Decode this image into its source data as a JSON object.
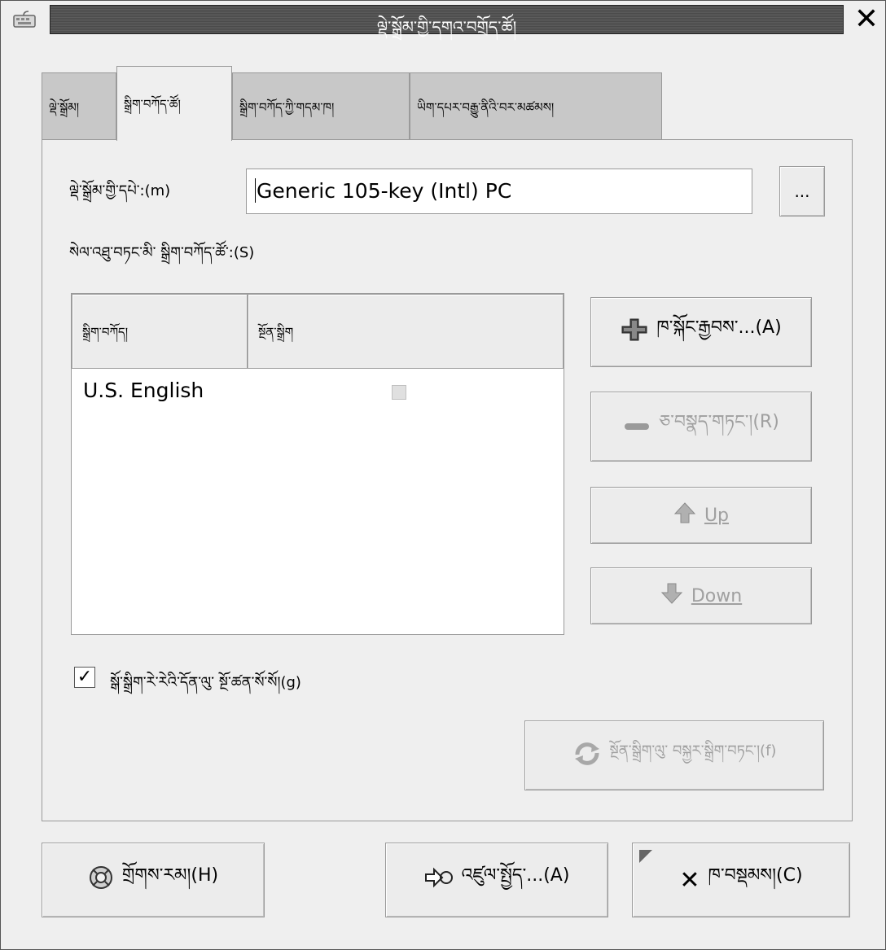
{
  "window": {
    "title": "ལྡེ་སྒྲོམ་གྱི་དགའ་བགྲོད་ཚོ།",
    "close_label": "✕"
  },
  "tabs": [
    {
      "label": "ལྡེ་སྒྲོམ།",
      "active": false
    },
    {
      "label": "སྒྲིག་བཀོད་ཚོ།",
      "active": true
    },
    {
      "label": "སྒྲིག་བཀོད་ཀྱི་གདམ་ཁ།",
      "active": false
    },
    {
      "label": "ཡིག་དཔར་བརྒྱུ་ནིའི་བར་མཚམས།",
      "active": false
    }
  ],
  "model": {
    "label": "ལྡེ་སྒྲོམ་གྱི་དཔེ་:(m)",
    "value": "Generic 105-key (Intl) PC",
    "browse_label": "..."
  },
  "layouts_label": "སེལ་འཐུ་བཏང་མི་ སྒྲིག་བཀོད་ཚོ་:(S)",
  "layouts_table": {
    "columns": [
      "སྒྲིག་བཀོད།",
      "སྔོན་སྒྲིག"
    ],
    "rows": [
      {
        "name": "U.S. English",
        "default": false
      }
    ]
  },
  "side_buttons": {
    "add": "ཁ་སྐོང་རྒྱབས་...(A)",
    "remove": "ཅ་བསྣད་གཏང་།(R)",
    "up": "Up",
    "down": "Down"
  },
  "separate_layout": {
    "label": "སྒོ་སྒྲིག་རེ་རེའི་དོན་ལུ་ སྔོ་ཚན་སོ་སོ།(g)",
    "checked": true,
    "check_glyph": "✓"
  },
  "reset_button": "སྔོན་སྒྲིག་ལུ་ བསྐྱར་སྒྲིག་བཏང་།(f)",
  "footer": {
    "help": "གྲོགས་རམ།(H)",
    "accessibility": "འཛུལ་སྤྱོད་...(A)",
    "close": "ཁ་བསྡམས།(C)"
  }
}
